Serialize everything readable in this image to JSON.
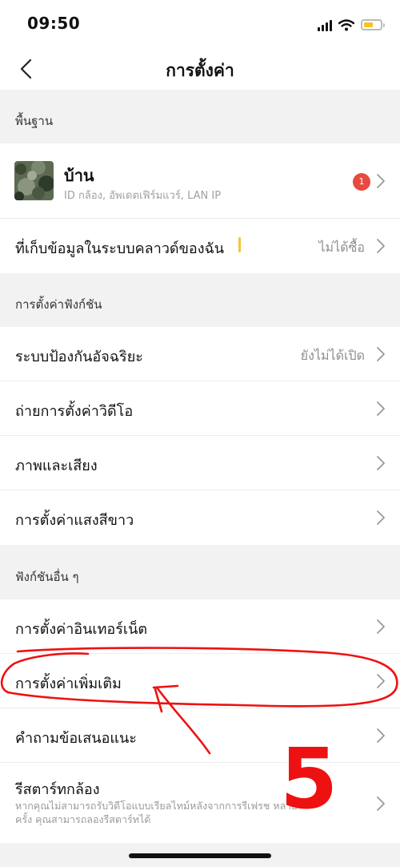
{
  "status_bar": {
    "time": "09:50",
    "signal_icon": "signal-icon",
    "wifi_icon": "wifi-icon",
    "battery_icon": "battery-icon",
    "battery_level": 0.6,
    "battery_color": "#f4c41a"
  },
  "nav": {
    "title": "การตั้งค่า",
    "back_icon": "chevron-left-icon"
  },
  "sections": [
    {
      "header": "พื้นฐาน",
      "device": {
        "name": "บ้าน",
        "subtitle": "ID กล้อง, อัพเดตเฟิร์มแวร์, LAN IP",
        "badge": "1"
      },
      "cloud": {
        "label": "ที่เก็บข้อมูลในระบบคลาวด์ของฉัน",
        "value": "ไม่ได้ซื้อ"
      }
    },
    {
      "header": "การตั้งค่าฟังก์ชัน",
      "items": [
        {
          "label": "ระบบป้องกันอัจฉริยะ",
          "value": "ยังไม่ได้เปิด"
        },
        {
          "label": "ถ่ายการตั้งค่าวิดีโอ"
        },
        {
          "label": "ภาพและเสียง"
        },
        {
          "label": "การตั้งค่าแสงสีขาว"
        }
      ]
    },
    {
      "header": "ฟังก์ชันอื่น ๆ",
      "items": [
        {
          "label": "การตั้งค่าอินเทอร์เน็ต"
        },
        {
          "label": "การตั้งค่าเพิ่มเติม"
        },
        {
          "label": "คำถามข้อเสนอแนะ"
        },
        {
          "label": "รีสตาร์ทกล้อง",
          "description": "หากคุณไม่สามารถรับวิดีโอแบบเรียลไทม์หลังจากการรีเฟรช หลายครั้ง คุณสามารถลองรีสตาร์ทได้"
        }
      ]
    }
  ],
  "annotation": {
    "number": "5",
    "color": "#ee1111"
  },
  "colors": {
    "section_bg": "#f2f2f2",
    "badge": "#e84a3f",
    "accent_mark": "#f7c431"
  }
}
